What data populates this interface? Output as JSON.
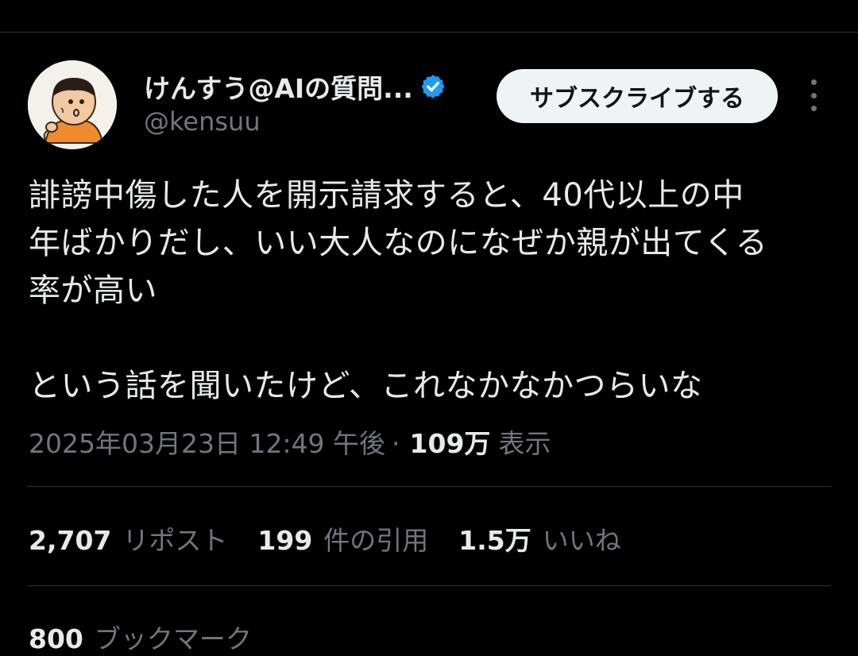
{
  "author": {
    "display_name": "けんすう@AIの質問...",
    "handle": "@kensuu",
    "verified_icon": "verified-badge-icon",
    "avatar_icon": "cartoon-avatar"
  },
  "actions": {
    "subscribe_label": "サブスクライブする",
    "more_icon": "more-vertical-icon"
  },
  "tweet": {
    "lines": [
      "誹謗中傷した人を開示請求すると、40代以上の中",
      "年ばかりだし、いい大人なのになぜか親が出てくる",
      "率が高い",
      "",
      "という話を聞いたけど、これなかなかつらいな"
    ],
    "timestamp": "2025年03月23日 12:49 午後",
    "separator": "·",
    "views_count": "109万",
    "views_label": "表示"
  },
  "stats": {
    "reposts_count": "2,707",
    "reposts_label": "リポスト",
    "quotes_count": "199",
    "quotes_label": "件の引用",
    "likes_count": "1.5万",
    "likes_label": "いいね",
    "bookmarks_count": "800",
    "bookmarks_label": "ブックマーク"
  },
  "colors": {
    "background": "#000000",
    "text_primary": "#e7e9ea",
    "text_secondary": "#71767b",
    "verified_blue": "#1d9bf0",
    "divider": "#2f3336",
    "button_bg": "#eff3f4"
  }
}
